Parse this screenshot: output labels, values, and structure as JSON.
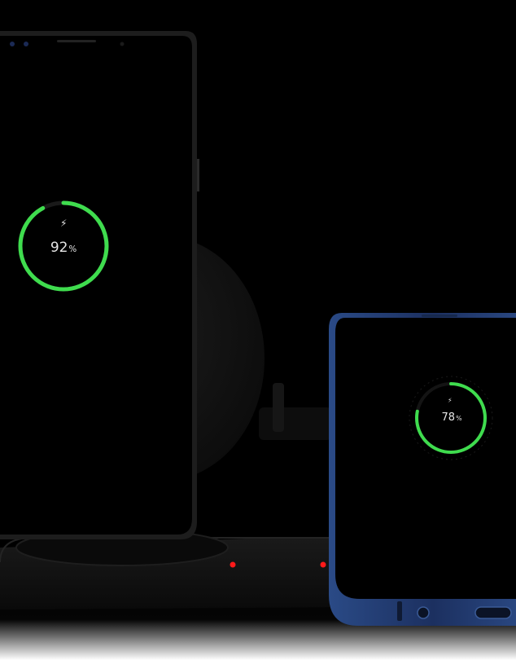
{
  "scene": {
    "colors": {
      "background": "#000000",
      "charging_ring": "#3fdc4e",
      "indicator_led": "#ff1a1a",
      "phone_right_frame": "#1f3360",
      "charger_pad": "#111111"
    },
    "phone_left": {
      "icon": "charging-bolt-icon",
      "percent_value": "92",
      "percent_unit": "%",
      "charge_level": 0.92
    },
    "phone_right": {
      "icon": "charging-bolt-icon",
      "percent_value": "78",
      "percent_unit": "%",
      "charge_level": 0.78
    },
    "charger": {
      "indicator_leds": 2
    }
  }
}
